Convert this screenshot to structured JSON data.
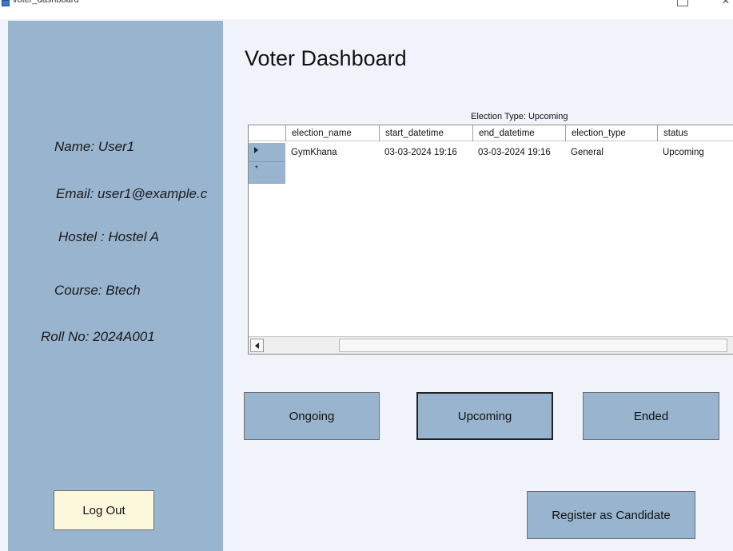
{
  "window": {
    "title": "voter_dashboard"
  },
  "colors": {
    "sidebar": "#98b4ce",
    "content_bg": "#f0f4fa",
    "logout_bg": "#fbf8dc",
    "button_bg": "#98b4ce"
  },
  "sidebar": {
    "name": "Name: User1",
    "email": "Email: user1@example.c",
    "hostel": "Hostel : Hostel A",
    "course": "Course: Btech",
    "roll": "Roll No: 2024A001",
    "logout_label": "Log Out"
  },
  "main": {
    "title": "Voter Dashboard",
    "filter_label": "Election Type: Upcoming",
    "table": {
      "columns": [
        "election_name",
        "start_datetime",
        "end_datetime",
        "election_type",
        "status"
      ],
      "rows": [
        [
          "GymKhana",
          "03-03-2024 19:16",
          "03-03-2024 19:16",
          "General",
          "Upcoming"
        ]
      ]
    },
    "buttons": {
      "ongoing": "Ongoing",
      "upcoming": "Upcoming",
      "ended": "Ended",
      "register": "Register as Candidate"
    }
  }
}
